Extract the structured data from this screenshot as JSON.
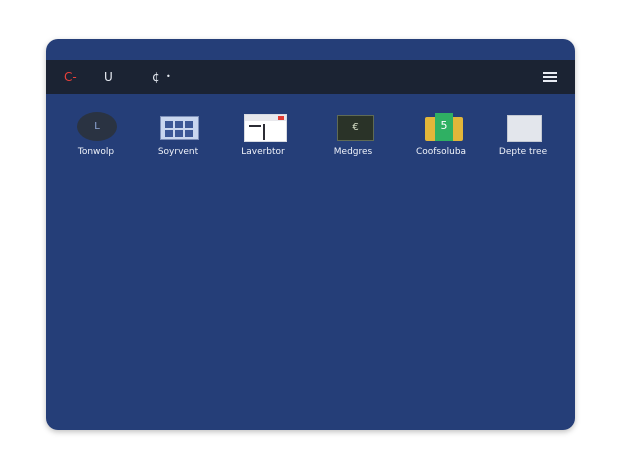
{
  "topbar": {
    "icons": [
      {
        "name": "power-icon",
        "glyph": "C-"
      },
      {
        "name": "undo-icon",
        "glyph": "U"
      },
      {
        "name": "settings-icon",
        "glyph": "¢"
      },
      {
        "name": "dot-icon",
        "glyph": "•"
      }
    ],
    "menu_icon": "hamburger-menu-icon"
  },
  "apps": [
    {
      "label": "Tonwolp",
      "icon": "clock-icon",
      "glyph": "L"
    },
    {
      "label": "Soyrvent",
      "icon": "software-grid-icon"
    },
    {
      "label": "Laverbtor",
      "icon": "layout-window-icon"
    },
    {
      "label": "Medgres",
      "icon": "media-icon",
      "glyph": "€"
    },
    {
      "label": "Coofsoluba",
      "icon": "folder-doc-icon",
      "glyph": "5"
    },
    {
      "label": "Depte tree",
      "icon": "blank-window-icon"
    }
  ],
  "colors": {
    "background": "#253e78",
    "topbar": "#1b2333",
    "accent_red": "#e8403a"
  }
}
